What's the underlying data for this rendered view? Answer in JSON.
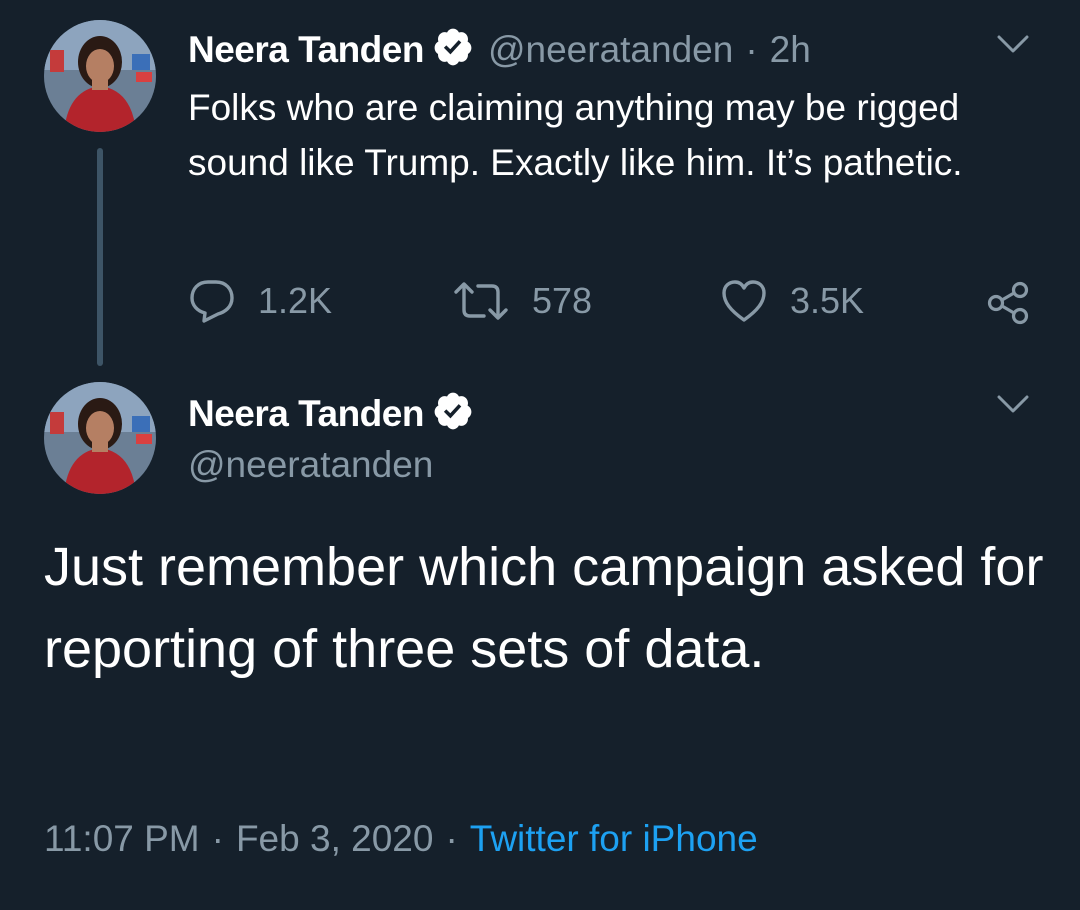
{
  "reply_to_tweet": {
    "author_name": "Neera Tanden",
    "handle": "@neeratanden",
    "time_separator": "·",
    "time_ago": "2h",
    "text": "Folks who are claiming anything may be rigged sound like Trump. Exactly like him. It’s pathetic.",
    "actions": {
      "replies": "1.2K",
      "retweets": "578",
      "likes": "3.5K"
    }
  },
  "main_tweet": {
    "author_name": "Neera Tanden",
    "handle": "@neeratanden",
    "text": "Just remember which campaign asked for reporting of three sets of data.",
    "timestamp_time": "11:07 PM",
    "separator": "·",
    "timestamp_date": "Feb 3, 2020",
    "source": "Twitter for iPhone"
  },
  "icons": {
    "verified": "verified-badge-icon",
    "reply": "reply-icon",
    "retweet": "retweet-icon",
    "like": "heart-icon",
    "share": "share-icon",
    "more": "chevron-down-icon"
  },
  "colors": {
    "background": "#15202b",
    "secondary_text": "#8899a6",
    "link": "#1da1f2",
    "thread_line": "#3d5466"
  }
}
